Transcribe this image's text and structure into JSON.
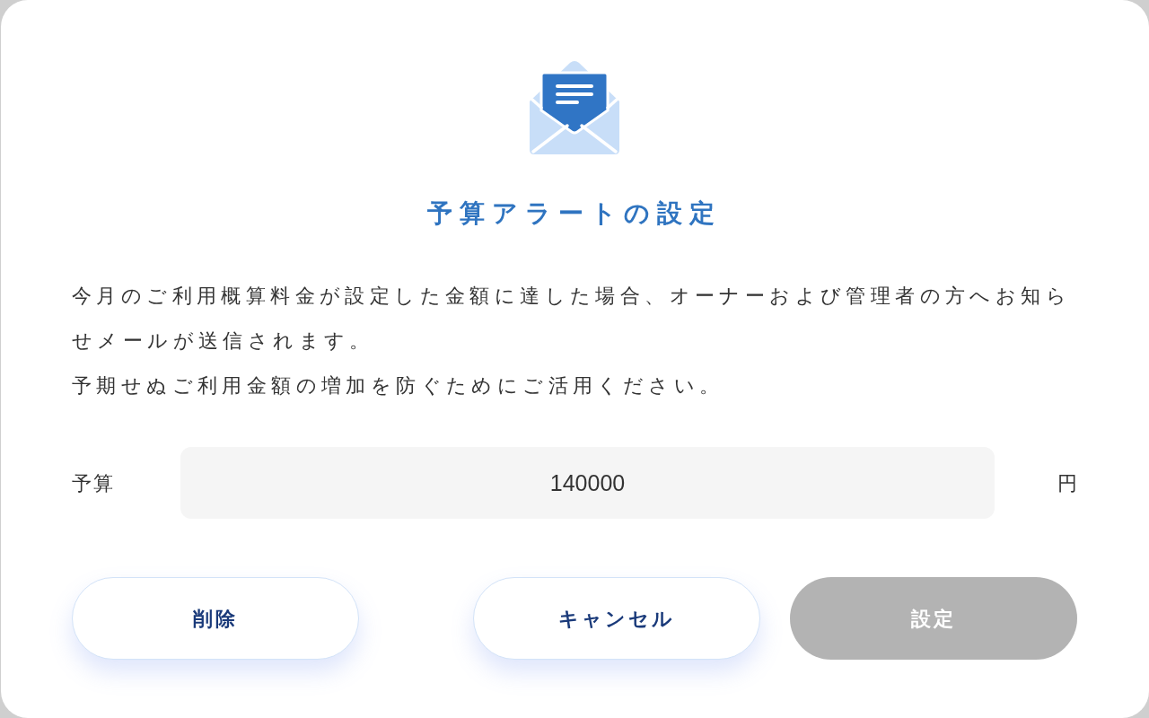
{
  "dialog": {
    "title": "予算アラートの設定",
    "description": [
      "今月のご利用概算料金が設定した金額に達した場合、オーナーおよび管理者の方へお知らせメールが送信されます。",
      "予期せぬご利用金額の増加を防ぐためにご活用ください。"
    ],
    "budget_field": {
      "label": "予算",
      "value": "140000",
      "unit": "円"
    },
    "buttons": [
      {
        "label": "削除",
        "kind": "delete",
        "disabled": false
      },
      {
        "label": "キャンセル",
        "kind": "cancel",
        "disabled": false
      },
      {
        "label": "設定",
        "kind": "submit",
        "disabled": true
      }
    ]
  }
}
